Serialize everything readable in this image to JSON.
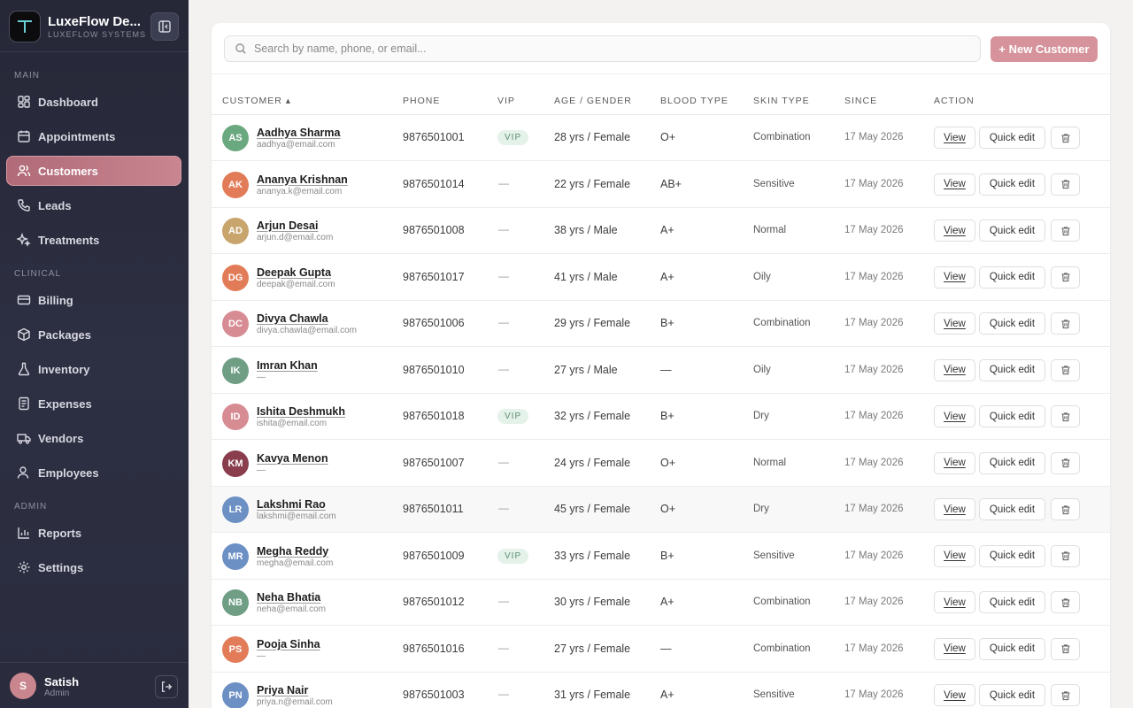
{
  "brand": {
    "name": "LuxeFlow De...",
    "subtitle": "LUXEFLOW SYSTEMS",
    "logo_icon": "logo-mark"
  },
  "sidebar": {
    "sections": {
      "main": "MAIN",
      "clinical": "CLINICAL",
      "admin": "ADMIN"
    },
    "items": [
      {
        "label": "Dashboard",
        "icon": "dashboard-icon"
      },
      {
        "label": "Appointments",
        "icon": "calendar-icon"
      },
      {
        "label": "Customers",
        "icon": "users-icon",
        "active": true
      },
      {
        "label": "Leads",
        "icon": "phone-icon"
      },
      {
        "label": "Treatments",
        "icon": "sparkle-icon"
      },
      {
        "label": "Billing",
        "icon": "card-icon"
      },
      {
        "label": "Packages",
        "icon": "package-icon"
      },
      {
        "label": "Inventory",
        "icon": "flask-icon"
      },
      {
        "label": "Expenses",
        "icon": "receipt-icon"
      },
      {
        "label": "Vendors",
        "icon": "truck-icon"
      },
      {
        "label": "Employees",
        "icon": "employee-icon"
      },
      {
        "label": "Reports",
        "icon": "chart-icon"
      },
      {
        "label": "Settings",
        "icon": "gear-icon"
      }
    ]
  },
  "user": {
    "initial": "S",
    "name": "Satish",
    "role": "Admin"
  },
  "toolbar": {
    "search_placeholder": "Search by name, phone, or email...",
    "new_button": "+ New Customer"
  },
  "table": {
    "headers": {
      "customer": "CUSTOMER ▴",
      "phone": "PHONE",
      "vip": "VIP",
      "age_gender": "AGE / GENDER",
      "blood": "BLOOD TYPE",
      "skin": "SKIN TYPE",
      "since": "SINCE",
      "action": "ACTION"
    },
    "actions": {
      "view": "View",
      "quick_edit": "Quick edit"
    },
    "vip_label": "VIP",
    "rows": [
      {
        "initials": "AS",
        "color": "#6aa87f",
        "name": "Aadhya Sharma",
        "email": "aadhya@email.com",
        "phone": "9876501001",
        "vip": true,
        "age_gender": "28 yrs / Female",
        "blood": "O+",
        "skin": "Combination",
        "since": "17 May 2026"
      },
      {
        "initials": "AK",
        "color": "#e27c58",
        "name": "Ananya Krishnan",
        "email": "ananya.k@email.com",
        "phone": "9876501014",
        "vip": false,
        "age_gender": "22 yrs / Female",
        "blood": "AB+",
        "skin": "Sensitive",
        "since": "17 May 2026"
      },
      {
        "initials": "AD",
        "color": "#c9a56e",
        "name": "Arjun Desai",
        "email": "arjun.d@email.com",
        "phone": "9876501008",
        "vip": false,
        "age_gender": "38 yrs / Male",
        "blood": "A+",
        "skin": "Normal",
        "since": "17 May 2026"
      },
      {
        "initials": "DG",
        "color": "#e27c58",
        "name": "Deepak Gupta",
        "email": "deepak@email.com",
        "phone": "9876501017",
        "vip": false,
        "age_gender": "41 yrs / Male",
        "blood": "A+",
        "skin": "Oily",
        "since": "17 May 2026"
      },
      {
        "initials": "DC",
        "color": "#d68c92",
        "name": "Divya Chawla",
        "email": "divya.chawla@email.com",
        "phone": "9876501006",
        "vip": false,
        "age_gender": "29 yrs / Female",
        "blood": "B+",
        "skin": "Combination",
        "since": "17 May 2026"
      },
      {
        "initials": "IK",
        "color": "#6f9e85",
        "name": "Imran Khan",
        "email": "—",
        "phone": "9876501010",
        "vip": false,
        "age_gender": "27 yrs / Male",
        "blood": "—",
        "skin": "Oily",
        "since": "17 May 2026"
      },
      {
        "initials": "ID",
        "color": "#d68c92",
        "name": "Ishita Deshmukh",
        "email": "ishita@email.com",
        "phone": "9876501018",
        "vip": true,
        "age_gender": "32 yrs / Female",
        "blood": "B+",
        "skin": "Dry",
        "since": "17 May 2026"
      },
      {
        "initials": "KM",
        "color": "#8a3e4d",
        "name": "Kavya Menon",
        "email": "—",
        "phone": "9876501007",
        "vip": false,
        "age_gender": "24 yrs / Female",
        "blood": "O+",
        "skin": "Normal",
        "since": "17 May 2026"
      },
      {
        "initials": "LR",
        "color": "#6c8fc4",
        "name": "Lakshmi Rao",
        "email": "lakshmi@email.com",
        "phone": "9876501011",
        "vip": false,
        "age_gender": "45 yrs / Female",
        "blood": "O+",
        "skin": "Dry",
        "since": "17 May 2026"
      },
      {
        "initials": "MR",
        "color": "#6c8fc4",
        "name": "Megha Reddy",
        "email": "megha@email.com",
        "phone": "9876501009",
        "vip": true,
        "age_gender": "33 yrs / Female",
        "blood": "B+",
        "skin": "Sensitive",
        "since": "17 May 2026"
      },
      {
        "initials": "NB",
        "color": "#6f9e85",
        "name": "Neha Bhatia",
        "email": "neha@email.com",
        "phone": "9876501012",
        "vip": false,
        "age_gender": "30 yrs / Female",
        "blood": "A+",
        "skin": "Combination",
        "since": "17 May 2026"
      },
      {
        "initials": "PS",
        "color": "#e27c58",
        "name": "Pooja Sinha",
        "email": "—",
        "phone": "9876501016",
        "vip": false,
        "age_gender": "27 yrs / Female",
        "blood": "—",
        "skin": "Combination",
        "since": "17 May 2026"
      },
      {
        "initials": "PN",
        "color": "#6c8fc4",
        "name": "Priya Nair",
        "email": "priya.n@email.com",
        "phone": "9876501003",
        "vip": false,
        "age_gender": "31 yrs / Female",
        "blood": "A+",
        "skin": "Sensitive",
        "since": "17 May 2026"
      }
    ]
  }
}
